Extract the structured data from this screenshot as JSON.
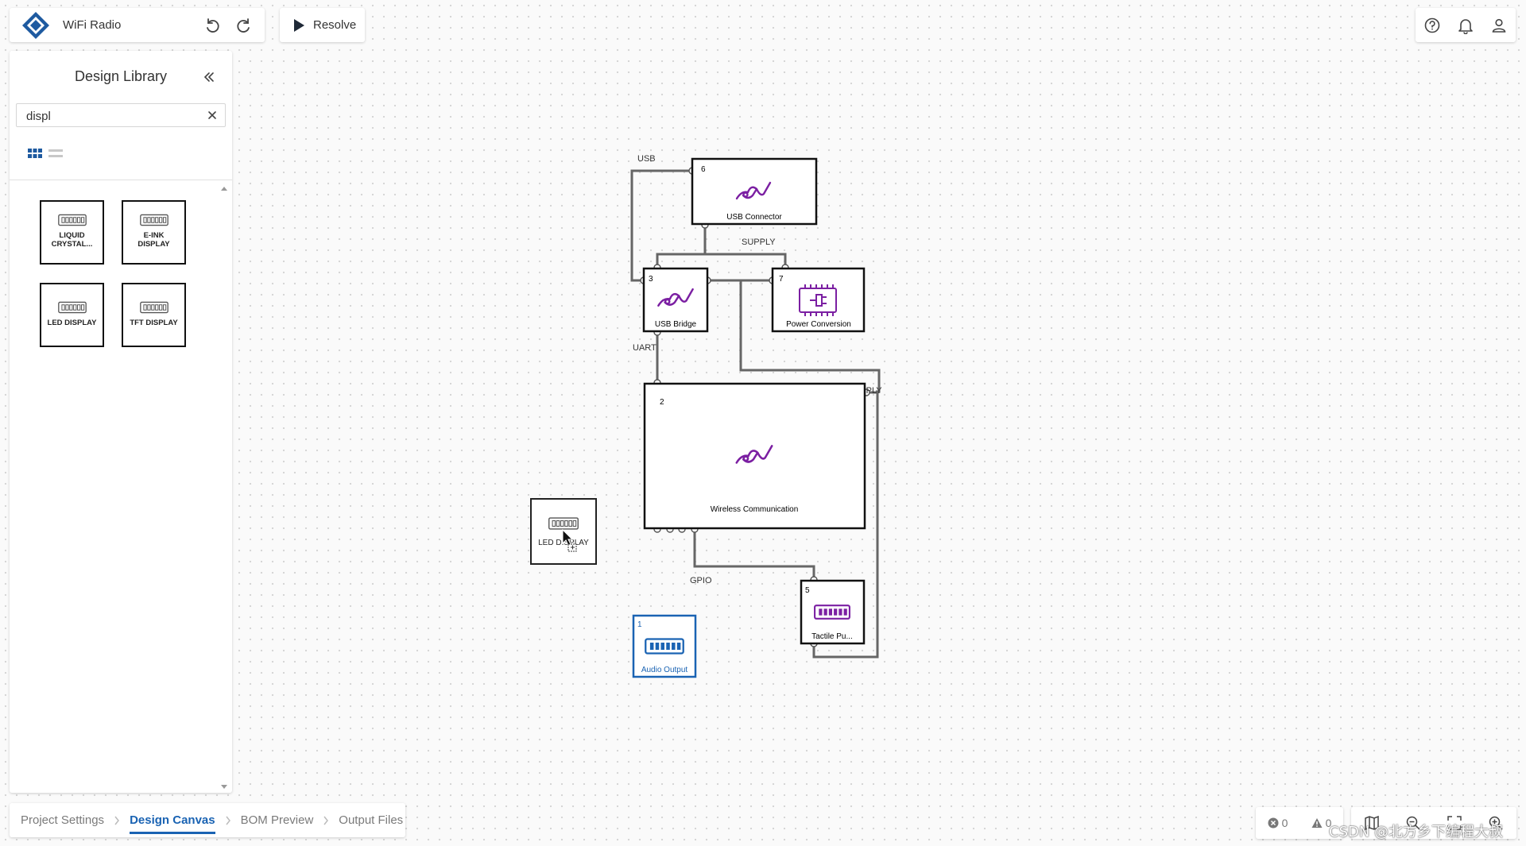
{
  "app": {
    "project_title": "WiFi Radio",
    "resolve_label": "Resolve",
    "brand_color": "#1e5aa0",
    "accent_color": "#1a63b3",
    "component_icon_color": "#7b1fa2"
  },
  "sidebar": {
    "title": "Design Library",
    "search_value": "displ",
    "results": [
      {
        "label_line1": "LIQUID",
        "label_line2": "CRYSTAL..."
      },
      {
        "label_line1": "E-INK",
        "label_line2": "DISPLAY"
      },
      {
        "label_line1": "LED DISPLAY",
        "label_line2": ""
      },
      {
        "label_line1": "TFT DISPLAY",
        "label_line2": ""
      }
    ]
  },
  "canvas": {
    "blocks": {
      "usb_connector": {
        "number": "6",
        "label": "USB Connector",
        "icon": "usb-cable-icon"
      },
      "usb_bridge": {
        "number": "3",
        "label": "USB Bridge",
        "icon": "usb-cable-icon"
      },
      "power_conversion": {
        "number": "7",
        "label": "Power Conversion",
        "icon": "power-chip-icon"
      },
      "wireless_communication": {
        "number": "2",
        "label": "Wireless Communication",
        "icon": "usb-cable-icon"
      },
      "tactile": {
        "number": "5",
        "label": "Tactile Pu...",
        "icon": "connector-chip-icon"
      },
      "audio_output": {
        "number": "1",
        "label": "Audio Output",
        "icon": "connector-chip-icon"
      },
      "dragging": {
        "label": "LED DISPLAY",
        "icon": "connector-chip-icon"
      }
    },
    "net_labels": {
      "usb": "USB",
      "supply_top": "SUPPLY",
      "uart": "UART",
      "supply_right": "SUPPLY",
      "gpio": "GPIO"
    }
  },
  "bottom_nav": {
    "tabs": [
      "Project Settings",
      "Design Canvas",
      "BOM Preview",
      "Output Files"
    ],
    "active": "Design Canvas"
  },
  "status": {
    "errors": "0",
    "warnings": "0"
  },
  "watermark": "CSDN @北方乡下编程大叔"
}
